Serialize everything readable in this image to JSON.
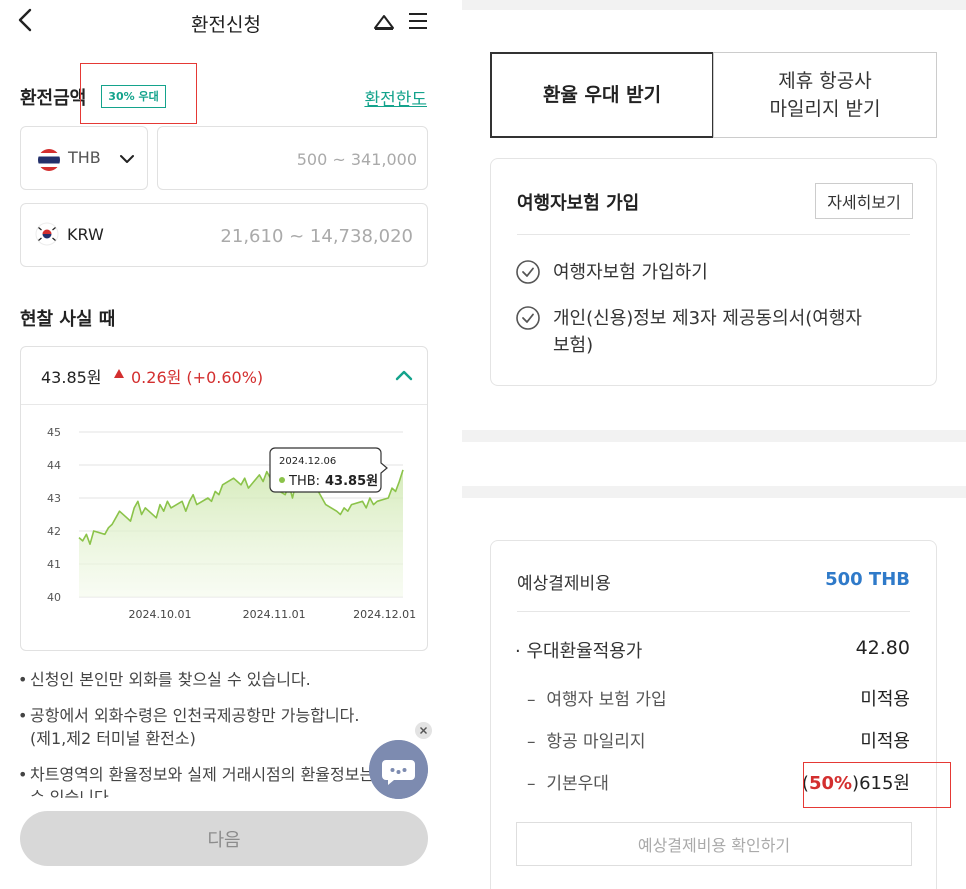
{
  "left": {
    "header": {
      "title": "환전신청"
    },
    "amount": {
      "label": "환전금액",
      "badge": "30% 우대",
      "limit_link": "환전한도",
      "currency_code": "THB",
      "amount_placeholder": "500 ~ 341,000",
      "krw_code": "KRW",
      "krw_placeholder": "21,610 ~ 14,738,020"
    },
    "cash_section": {
      "title": "현찰 사실 때"
    },
    "rate_card": {
      "rate": "43.85원",
      "change": "0.26원 (+0.60%)",
      "up_color": "#d32f2f"
    },
    "chart_data": {
      "type": "area",
      "title": "",
      "xlabel": "",
      "ylabel": "",
      "ylim": [
        40,
        45
      ],
      "yticks": [
        "45",
        "44",
        "43",
        "42",
        "41",
        "40"
      ],
      "xtick_labels": [
        "2024.10.01",
        "2024.11.01",
        "2024.12.01"
      ],
      "grid": true,
      "line_color": "#8bc34a",
      "series": [
        {
          "name": "THB",
          "x": [
            "2024.09.09",
            "2024.09.10",
            "2024.09.11",
            "2024.09.12",
            "2024.09.13",
            "2024.09.16",
            "2024.09.17",
            "2024.09.18",
            "2024.09.19",
            "2024.09.20",
            "2024.09.23",
            "2024.09.24",
            "2024.09.25",
            "2024.09.26",
            "2024.09.27",
            "2024.09.30",
            "2024.10.01",
            "2024.10.02",
            "2024.10.03",
            "2024.10.04",
            "2024.10.07",
            "2024.10.08",
            "2024.10.09",
            "2024.10.10",
            "2024.10.11",
            "2024.10.14",
            "2024.10.15",
            "2024.10.16",
            "2024.10.17",
            "2024.10.18",
            "2024.10.21",
            "2024.10.22",
            "2024.10.23",
            "2024.10.24",
            "2024.10.25",
            "2024.10.28",
            "2024.10.29",
            "2024.10.30",
            "2024.10.31",
            "2024.11.01",
            "2024.11.04",
            "2024.11.05",
            "2024.11.06",
            "2024.11.07",
            "2024.11.08",
            "2024.11.11",
            "2024.11.12",
            "2024.11.13",
            "2024.11.14",
            "2024.11.15",
            "2024.11.18",
            "2024.11.19",
            "2024.11.20",
            "2024.11.21",
            "2024.11.22",
            "2024.11.25",
            "2024.11.26",
            "2024.11.27",
            "2024.11.28",
            "2024.11.29",
            "2024.12.02",
            "2024.12.03",
            "2024.12.04",
            "2024.12.05",
            "2024.12.06"
          ],
          "values": [
            41.8,
            41.7,
            41.9,
            41.6,
            42.0,
            41.9,
            42.1,
            42.2,
            42.4,
            42.6,
            42.3,
            42.7,
            42.9,
            42.5,
            42.7,
            42.4,
            42.8,
            42.6,
            42.9,
            42.7,
            42.9,
            42.6,
            42.9,
            43.1,
            42.8,
            43.0,
            42.9,
            43.2,
            43.1,
            43.4,
            43.6,
            43.5,
            43.4,
            43.6,
            43.3,
            43.7,
            43.5,
            43.8,
            43.6,
            43.3,
            43.1,
            43.4,
            43.0,
            43.5,
            43.3,
            43.6,
            43.4,
            43.2,
            43.0,
            42.8,
            42.6,
            42.5,
            42.7,
            42.6,
            42.8,
            42.9,
            42.7,
            43.0,
            42.8,
            42.9,
            43.0,
            43.3,
            43.2,
            43.5,
            43.85
          ]
        }
      ],
      "tooltip": {
        "date": "2024.12.06",
        "label": "THB:",
        "value": "43.85원"
      }
    },
    "notes": [
      {
        "text": "신청인 본인만 외화를 찾으실 수 있습니다."
      },
      {
        "text": "공항에서 외화수령은 인천국제공항만 가능합니다.",
        "sub": "(제1,제2 터미널 환전소)"
      },
      {
        "text": "차트영역의 환율정보와 실제 거래시점의 환율정보는",
        "sub": "수 있습니다"
      }
    ],
    "next_button": "다음"
  },
  "right": {
    "tabs": {
      "rate_benefit": "환율 우대 받기",
      "airline_line1": "제휴 항공사",
      "airline_line2": "마일리지 받기"
    },
    "insurance": {
      "title": "여행자보험 가입",
      "detail_button": "자세히보기",
      "items": [
        {
          "text": "여행자보험 가입하기"
        },
        {
          "text": "개인(신용)정보 제3자 제공동의서(여행자보험)"
        }
      ]
    },
    "cost": {
      "title": "예상결제비용",
      "total": "500 THB",
      "rows": [
        {
          "label": "우대환율적용가",
          "value": "42.80"
        },
        {
          "label": "여행자 보험 가입",
          "value": "미적용"
        },
        {
          "label": "항공 마일리지",
          "value": "미적용"
        },
        {
          "label": "기본우대",
          "value_pre": "(",
          "value_pct": "50%",
          "value_post": ")615원"
        }
      ],
      "confirm_button": "예상결제비용 확인하기"
    },
    "accent_color": "#2f7ac9",
    "brand_color": "#14a38c"
  }
}
